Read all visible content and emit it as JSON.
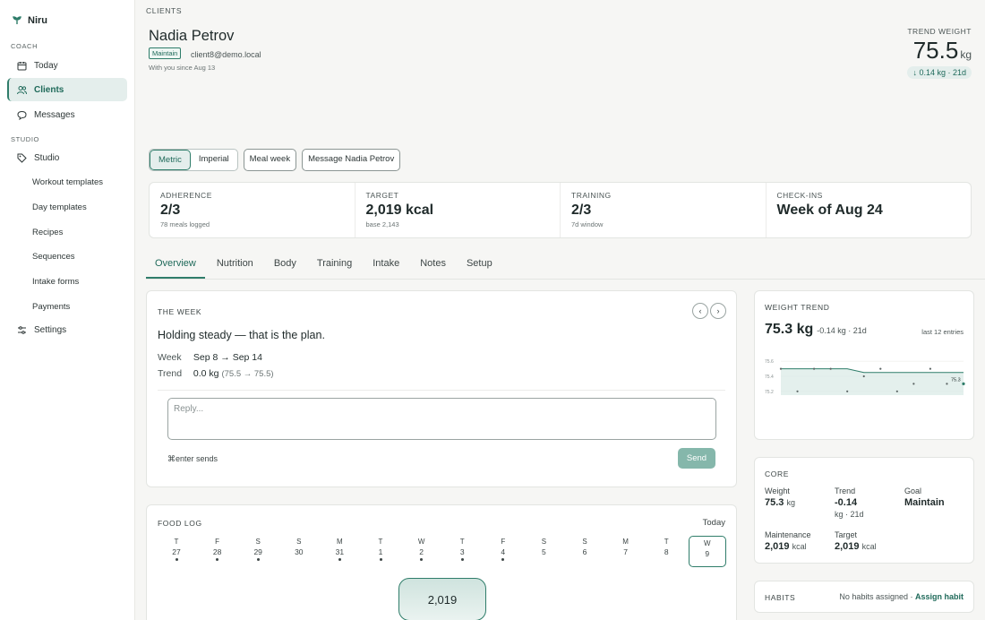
{
  "brand": {
    "name": "Niru"
  },
  "sidebar": {
    "coach_label": "COACH",
    "studio_label": "STUDIO",
    "items": [
      {
        "label": "Today",
        "icon": "calendar-icon"
      },
      {
        "label": "Clients",
        "icon": "users-icon"
      },
      {
        "label": "Messages",
        "icon": "chat-icon"
      },
      {
        "label": "Studio",
        "icon": "tag-icon"
      },
      {
        "label": "Settings",
        "icon": "sliders-icon"
      }
    ],
    "studio_items": [
      "Workout templates",
      "Day templates",
      "Recipes",
      "Sequences",
      "Intake forms",
      "Payments"
    ]
  },
  "header": {
    "breadcrumb": "CLIENTS",
    "name": "Nadia Petrov",
    "goal_badge": "Maintain",
    "email": "client8@demo.local",
    "since": "With you since Aug 13",
    "trend_label": "TREND WEIGHT",
    "trend_value": "75.5",
    "trend_unit": "kg",
    "trend_delta": "↓ 0.14 kg · 21d"
  },
  "actions": {
    "metric": "Metric",
    "imperial": "Imperial",
    "meal_week": "Meal week",
    "message": "Message Nadia Petrov"
  },
  "stats": [
    {
      "label": "ADHERENCE",
      "value": "2/3",
      "sub": "78 meals logged"
    },
    {
      "label": "TARGET",
      "value": "2,019 kcal",
      "sub": "base 2,143"
    },
    {
      "label": "TRAINING",
      "value": "2/3",
      "sub": "7d window"
    },
    {
      "label": "CHECK-INS",
      "value": "Week of Aug 24",
      "sub": ""
    }
  ],
  "tabs": [
    "Overview",
    "Nutrition",
    "Body",
    "Training",
    "Intake",
    "Notes",
    "Setup"
  ],
  "week": {
    "title": "THE WEEK",
    "headline": "Holding steady — that is the plan.",
    "week_key": "Week",
    "week_val": "Sep 8 → Sep 14",
    "trend_key": "Trend",
    "trend_val": "0.0 kg",
    "trend_detail": "(75.5 → 75.5)",
    "reply_placeholder": "Reply...",
    "hint": "⌘enter sends",
    "send": "Send",
    "prev": "‹",
    "next": "›"
  },
  "food_log": {
    "title": "FOOD LOG",
    "today": "Today",
    "days": [
      {
        "d": "T",
        "n": "27",
        "dot": true
      },
      {
        "d": "F",
        "n": "28",
        "dot": true
      },
      {
        "d": "S",
        "n": "29",
        "dot": true
      },
      {
        "d": "S",
        "n": "30",
        "dot": false
      },
      {
        "d": "M",
        "n": "31",
        "dot": true
      },
      {
        "d": "T",
        "n": "1",
        "dot": true
      },
      {
        "d": "W",
        "n": "2",
        "dot": true
      },
      {
        "d": "T",
        "n": "3",
        "dot": true
      },
      {
        "d": "F",
        "n": "4",
        "dot": true
      },
      {
        "d": "S",
        "n": "5",
        "dot": false
      },
      {
        "d": "S",
        "n": "6",
        "dot": false
      },
      {
        "d": "M",
        "n": "7",
        "dot": false
      },
      {
        "d": "T",
        "n": "8",
        "dot": false
      },
      {
        "d": "W",
        "n": "9",
        "dot": false
      }
    ],
    "kcal": "2,019"
  },
  "weight_trend": {
    "title": "WEIGHT TREND",
    "value": "75.3 kg",
    "delta": "-0.14 kg · 21d",
    "entries": "last 12 entries",
    "y_ticks": [
      "75.6",
      "75.4",
      "75.2"
    ],
    "last_label": "75.3",
    "accent": "#2f7d6a"
  },
  "chart_data": {
    "type": "line",
    "title": "",
    "ylim": [
      75.15,
      75.65
    ],
    "trend": [
      75.5,
      75.5,
      75.5,
      75.5,
      75.5,
      75.45,
      75.45,
      75.45,
      75.45,
      75.45,
      75.45,
      75.45
    ],
    "entries": [
      75.5,
      75.2,
      75.5,
      75.5,
      75.2,
      75.4,
      75.5,
      75.2,
      75.3,
      75.5,
      75.3,
      75.3
    ]
  },
  "core": {
    "title": "CORE",
    "weight_k": "Weight",
    "weight_v": "75.3",
    "weight_u": "kg",
    "trend_k": "Trend",
    "trend_v": "-0.14",
    "trend_s": "kg · 21d",
    "goal_k": "Goal",
    "goal_v": "Maintain",
    "maint_k": "Maintenance",
    "maint_v": "2,019",
    "maint_u": "kcal",
    "target_k": "Target",
    "target_v": "2,019",
    "target_u": "kcal"
  },
  "habits": {
    "title": "HABITS",
    "note": "No habits assigned ·",
    "assign": "Assign habit"
  }
}
